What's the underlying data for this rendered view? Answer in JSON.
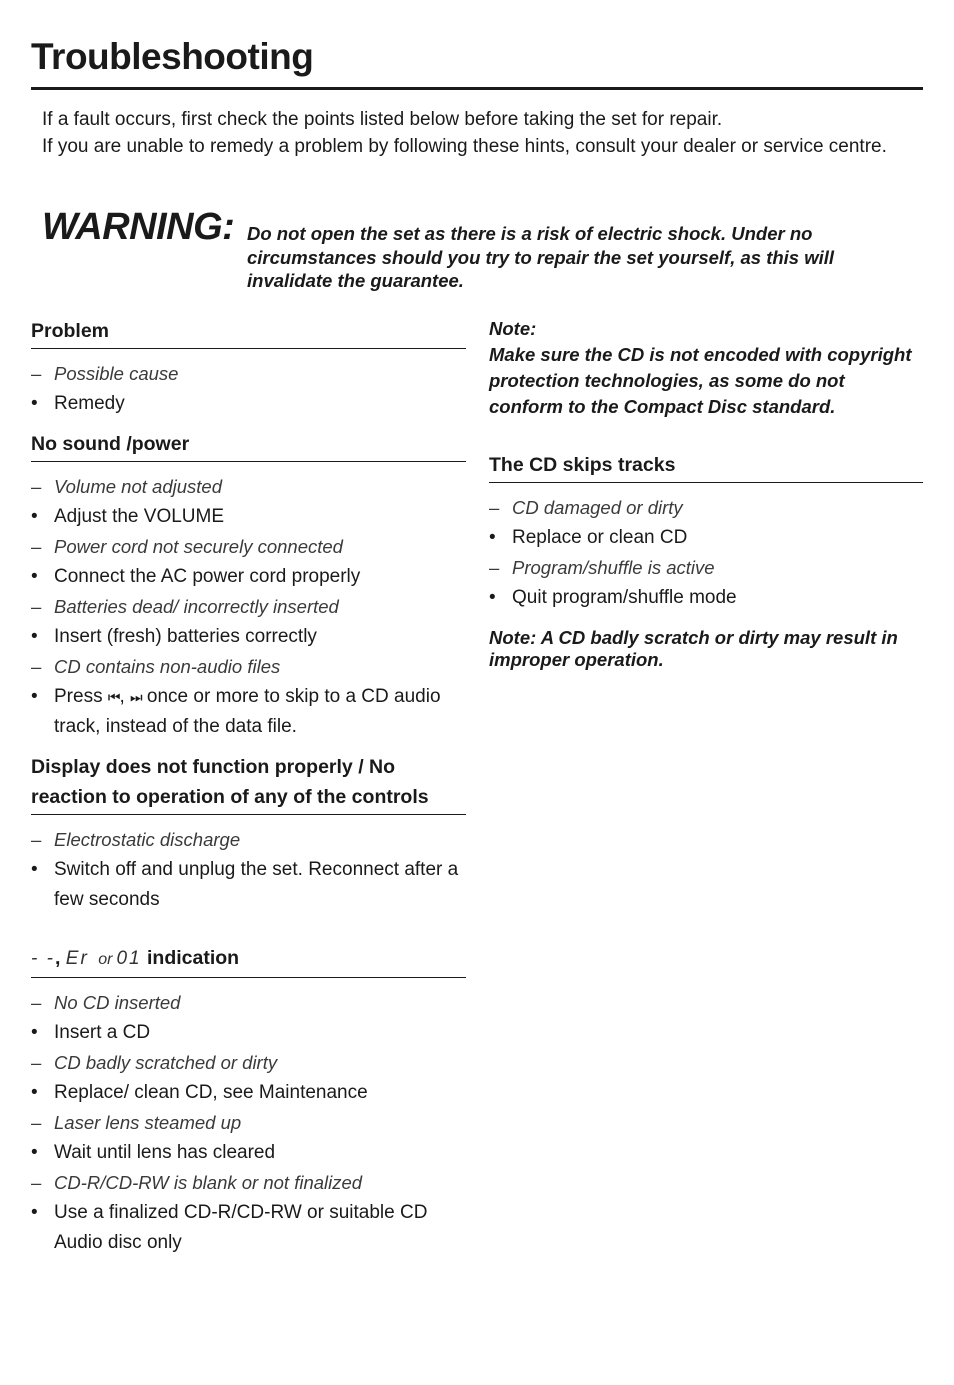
{
  "page": {
    "title": "Troubleshooting",
    "intro": [
      "If a fault occurs, first check the points listed below before taking the set for repair.",
      "If you are unable to remedy a problem by following these hints, consult your dealer or service centre."
    ],
    "warning": {
      "label": "WARNING:",
      "text": "Do not open the set as there is a risk of electric shock. Under no circumstances should you try to repair the set yourself, as this will invalidate the guarantee."
    }
  },
  "left_column": {
    "legend": {
      "heading": "Problem",
      "cause": "Possible cause",
      "remedy": "Remedy"
    },
    "no_sound": {
      "heading": "No sound /power",
      "items": [
        {
          "type": "cause",
          "text": "Volume not adjusted"
        },
        {
          "type": "remedy",
          "text": "Adjust the VOLUME"
        },
        {
          "type": "cause",
          "text": "Power cord not securely connected"
        },
        {
          "type": "remedy",
          "text": "Connect the AC power cord properly"
        },
        {
          "type": "cause",
          "text": "Batteries dead/ incorrectly inserted"
        },
        {
          "type": "remedy",
          "text": "Insert (fresh) batteries correctly"
        },
        {
          "type": "cause",
          "text": "CD contains non-audio files"
        }
      ],
      "press_item": {
        "prefix": "Press",
        "prev_icon": "skip-previous-icon",
        "prev_glyph": "⏮",
        "separator": ",",
        "next_icon": "skip-next-icon",
        "next_glyph": "⏭",
        "suffix": "once or more to skip to a CD audio track, instead of the data file."
      }
    },
    "display": {
      "heading": "Display does not function properly / No reaction to operation of any of the controls",
      "items": [
        {
          "type": "cause",
          "text": "Electrostatic discharge"
        },
        {
          "type": "remedy",
          "text": "Switch off and unplug the set. Reconnect after a few seconds"
        }
      ]
    },
    "indication": {
      "seg1": "- -",
      "comma": ",",
      "seg2": "Er",
      "or": "or",
      "seg3": "01",
      "label": "indication",
      "items": [
        {
          "type": "cause",
          "text": "No CD inserted"
        },
        {
          "type": "remedy",
          "text": "Insert a CD"
        },
        {
          "type": "cause",
          "text": "CD badly scratched or dirty"
        },
        {
          "type": "remedy",
          "text": "Replace/ clean CD, see Maintenance"
        },
        {
          "type": "cause",
          "text": "Laser lens steamed up"
        },
        {
          "type": "remedy",
          "text": "Wait until lens has cleared"
        },
        {
          "type": "cause",
          "text": "CD-R/CD-RW is blank or not finalized"
        },
        {
          "type": "remedy",
          "text": "Use a finalized CD-R/CD-RW or suitable CD Audio disc only"
        }
      ]
    }
  },
  "right_column": {
    "note": {
      "label": "Note:",
      "text": "Make sure the CD is not encoded with copyright protection technologies, as some do not conform to the Compact Disc standard."
    },
    "skips": {
      "heading": "The CD skips tracks",
      "items": [
        {
          "type": "cause",
          "text": "CD damaged or dirty"
        },
        {
          "type": "remedy",
          "text": "Replace or clean CD"
        },
        {
          "type": "cause",
          "text": "Program/shuffle is active"
        },
        {
          "type": "remedy",
          "text": "Quit program/shuffle mode"
        }
      ],
      "note": "Note: A CD badly scratch or dirty may result in improper operation."
    }
  },
  "markers": {
    "cause": "–",
    "remedy": "•"
  }
}
